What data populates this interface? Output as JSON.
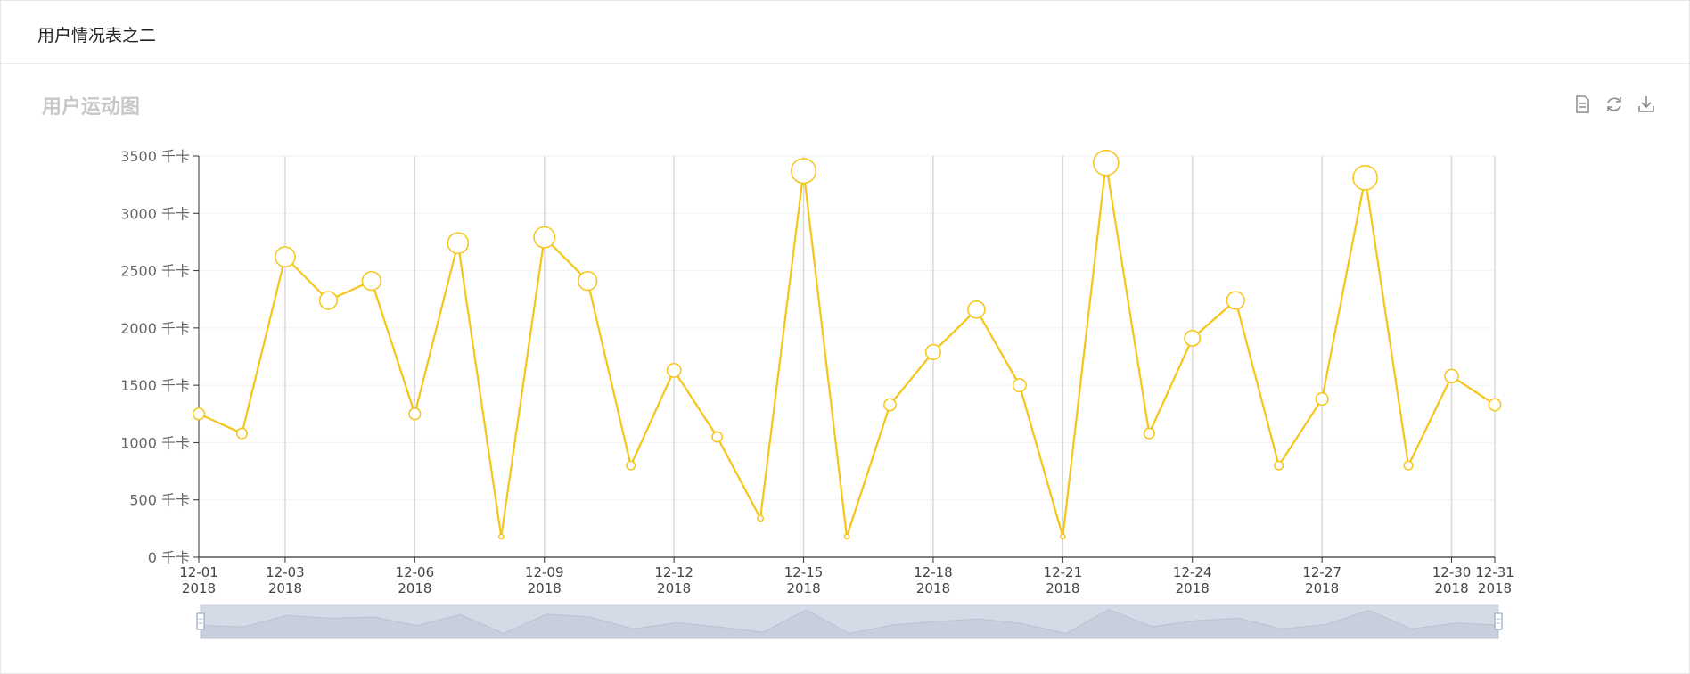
{
  "panel": {
    "title": "用户情况表之二"
  },
  "toolbox": {
    "icons": [
      "data-view-icon",
      "restore-icon",
      "save-image-icon"
    ]
  },
  "colors": {
    "line": "#f5c518",
    "grid": "#d9d9d9",
    "slider_fill": "#d4dae6",
    "slider_handle": "#a7b7cc"
  },
  "chart_data": {
    "type": "line",
    "title": "用户运动图",
    "y_unit": "千卡",
    "ylim": [
      0,
      3500
    ],
    "y_ticks": [
      0,
      500,
      1000,
      1500,
      2000,
      2500,
      3000,
      3500
    ],
    "y_tick_labels": [
      "0 千卡",
      "500 千卡",
      "1000 千卡",
      "1500 千卡",
      "2000 千卡",
      "2500 千卡",
      "3000 千卡",
      "3500 千卡"
    ],
    "x_axis": "time",
    "x_range": [
      "2018-12-01",
      "2018-12-31"
    ],
    "x_tick_labels": [
      [
        "12-01",
        "2018"
      ],
      [
        "12-03",
        "2018"
      ],
      [
        "12-06",
        "2018"
      ],
      [
        "12-09",
        "2018"
      ],
      [
        "12-12",
        "2018"
      ],
      [
        "12-15",
        "2018"
      ],
      [
        "12-18",
        "2018"
      ],
      [
        "12-21",
        "2018"
      ],
      [
        "12-24",
        "2018"
      ],
      [
        "12-27",
        "2018"
      ],
      [
        "12-30",
        "2018"
      ],
      [
        "12-31",
        "2018"
      ]
    ],
    "x_tick_dates": [
      "2018-12-01",
      "2018-12-03",
      "2018-12-06",
      "2018-12-09",
      "2018-12-12",
      "2018-12-15",
      "2018-12-18",
      "2018-12-21",
      "2018-12-24",
      "2018-12-27",
      "2018-12-30",
      "2018-12-31"
    ],
    "series": [
      {
        "dates": [
          "2018-12-01",
          "2018-12-02",
          "2018-12-03",
          "2018-12-04",
          "2018-12-05",
          "2018-12-06",
          "2018-12-07",
          "2018-12-08",
          "2018-12-09",
          "2018-12-10",
          "2018-12-11",
          "2018-12-12",
          "2018-12-13",
          "2018-12-14",
          "2018-12-15",
          "2018-12-16",
          "2018-12-17",
          "2018-12-18",
          "2018-12-19",
          "2018-12-20",
          "2018-12-21",
          "2018-12-22",
          "2018-12-23",
          "2018-12-24",
          "2018-12-25",
          "2018-12-26",
          "2018-12-27",
          "2018-12-28",
          "2018-12-29",
          "2018-12-30",
          "2018-12-31"
        ],
        "values": [
          1250,
          1080,
          2620,
          2240,
          2410,
          1250,
          2740,
          180,
          2790,
          2410,
          800,
          1630,
          1050,
          340,
          3370,
          180,
          1330,
          1790,
          2160,
          1500,
          180,
          3440,
          1080,
          1910,
          2240,
          800,
          1380,
          3310,
          800,
          1580,
          1330
        ]
      }
    ],
    "legend": "none",
    "grid": true,
    "dataZoom": {
      "start": "2018-12-01",
      "end": "2018-12-31"
    }
  }
}
